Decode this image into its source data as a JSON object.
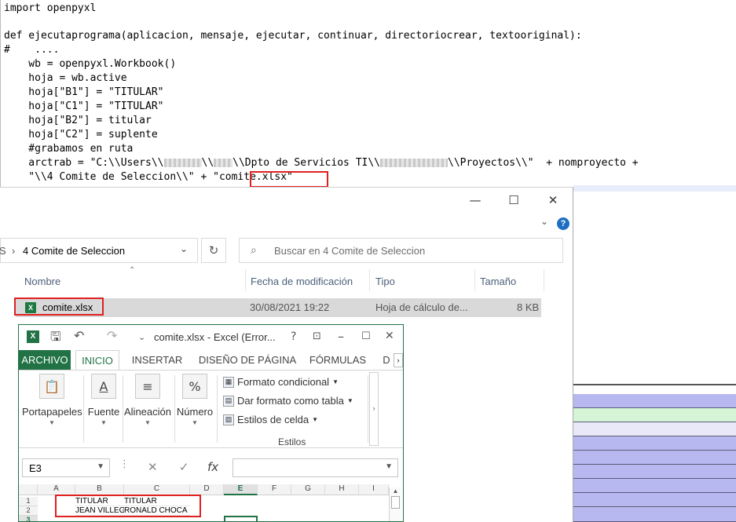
{
  "code": {
    "lines": [
      "import openpyxl",
      "",
      "def ejecutaprograma(aplicacion, mensaje, ejecutar, continuar, directoriocrear, textooriginal):",
      "#    ....",
      "    wb = openpyxl.Workbook()",
      "    hoja = wb.active",
      "    hoja[\"B1\"] = \"TITULAR\"",
      "    hoja[\"C1\"] = \"TITULAR\"",
      "    hoja[\"B2\"] = titular",
      "    hoja[\"C2\"] = suplente",
      "    #grabamos en ruta"
    ],
    "line12_a": "    arctrab = \"C:\\\\Users\\\\",
    "line12_b": "\\\\",
    "line12_c": "\\\\Dpto de Servicios TI\\\\",
    "line12_d": "\\\\Proyectos\\\\\"  + nomproyecto +",
    "line13_a": "    \"\\\\4 Comite de Seleccion\\\\\" + \"",
    "line13_b": "comite.xlsx",
    "line13_c": "\""
  },
  "explorer": {
    "window_controls": {
      "minimize": "—",
      "maximize": "☐",
      "close": "✕"
    },
    "nav_chevron": "⌄",
    "help": "?",
    "breadcrumb": "4 Comite de Seleccion",
    "breadcrumb_prefix": "S",
    "search_placeholder": "Buscar en 4 Comite de Seleccion",
    "columns": {
      "name": "Nombre",
      "date": "Fecha de modificación",
      "type": "Tipo",
      "size": "Tamaño"
    },
    "file": {
      "name": "comite.xlsx",
      "date": "30/08/2021 19:22",
      "type": "Hoja de cálculo de...",
      "size": "8 KB"
    }
  },
  "excel": {
    "title": "comite.xlsx - Excel (Error...",
    "title_help": "?",
    "tabs": [
      "ARCHIVO",
      "INICIO",
      "INSERTAR",
      "DISEÑO DE PÁGINA",
      "FÓRMULAS",
      "D"
    ],
    "ribbon": {
      "portapapeles": "Portapapeles",
      "fuente": "Fuente",
      "alineacion": "Alineación",
      "numero": "Número",
      "styles": [
        "Formato condicional",
        "Dar formato como tabla",
        "Estilos de celda"
      ],
      "styles_group": "Estilos",
      "number_symbol": "%",
      "font_symbol": "A"
    },
    "name_box": "E3",
    "fx_label": "fx",
    "columns": [
      "A",
      "B",
      "C",
      "D",
      "E",
      "F",
      "G",
      "H",
      "I"
    ],
    "rows": [
      "1",
      "2",
      "3"
    ],
    "cells": {
      "B1": "TITULAR",
      "C1": "TITULAR",
      "B2": "JEAN VILLEGAS",
      "C2": "RONALD CHOCA"
    }
  },
  "colors": {
    "excel_green": "#217346",
    "highlight_red": "#e02020",
    "band_purple": "#b8b8f0",
    "band_green": "#d6f5d6"
  }
}
